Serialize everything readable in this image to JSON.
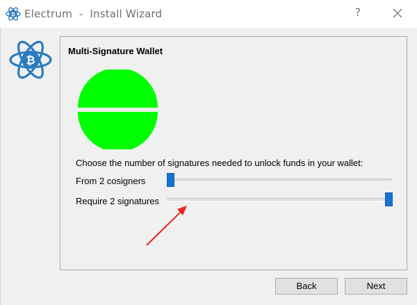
{
  "window": {
    "title": "Electrum  -  Install Wizard",
    "help_glyph": "?",
    "close_icon": "close-icon",
    "app_icon": "electrum-bitcoin-icon"
  },
  "panel": {
    "title": "Multi-Signature Wallet",
    "pie": {
      "color": "#00ff00",
      "split_color": "#ffffff"
    },
    "description": "Choose the number of signatures needed to unlock funds in your wallet:",
    "cosigners": {
      "label": "From 2 cosigners",
      "value": 2,
      "position": 0
    },
    "signatures": {
      "label": "Require 2 signatures",
      "value": 2,
      "position": 1
    }
  },
  "buttons": {
    "back": "Back",
    "next": "Next"
  },
  "colors": {
    "slider_handle": "#1773d2",
    "annotation_arrow": "#e8231f",
    "brand": "#2b7bbf"
  }
}
